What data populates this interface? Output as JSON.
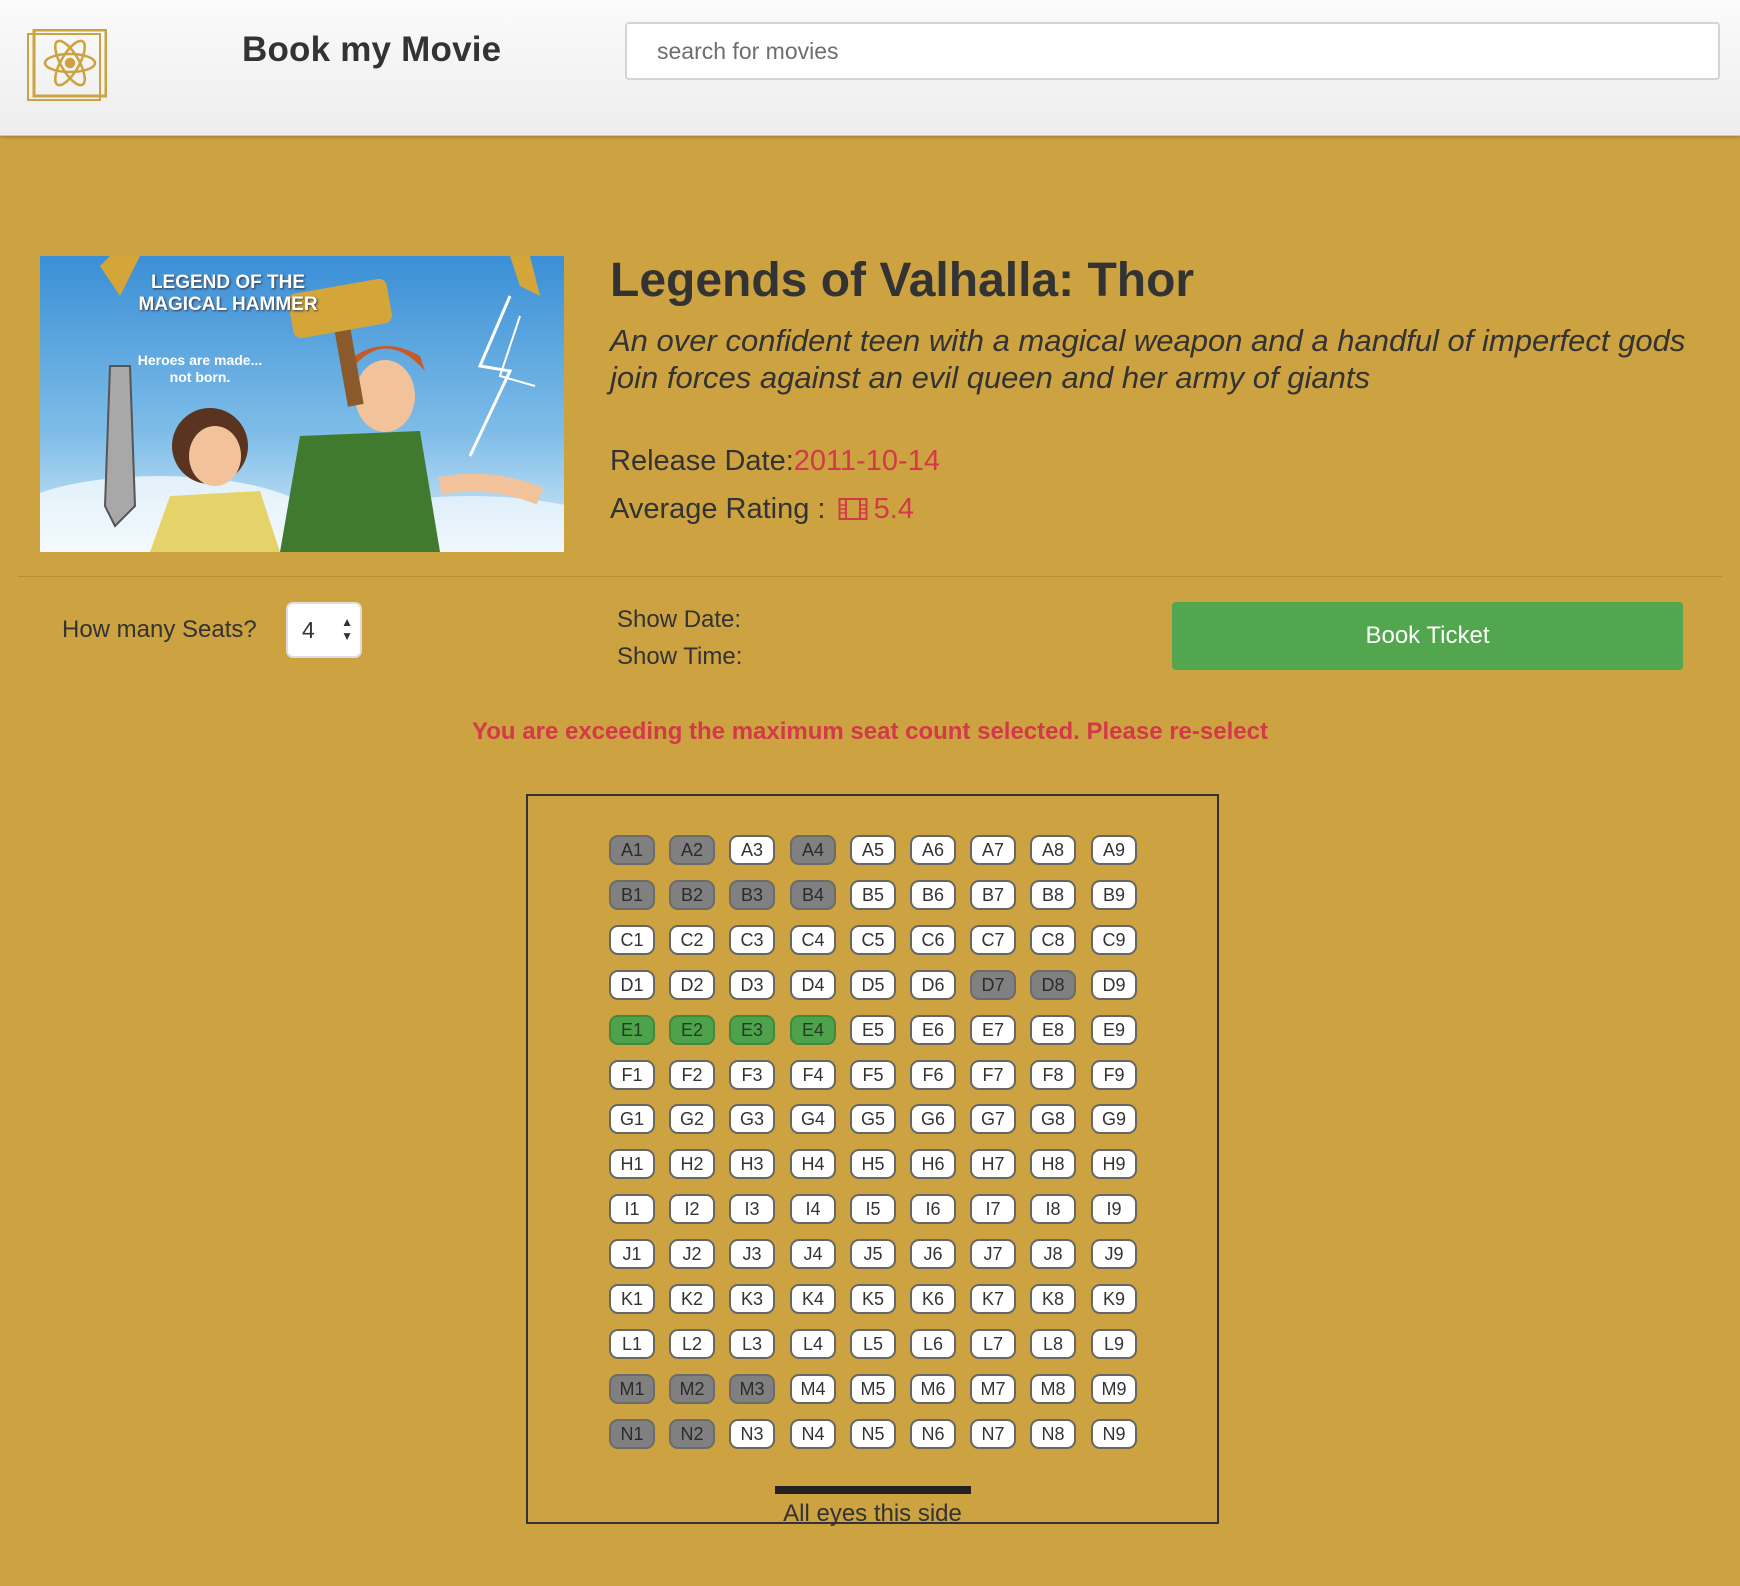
{
  "header": {
    "logo_icon": "react-atom-icon",
    "brand": "Book my Movie",
    "search_placeholder": "search for movies"
  },
  "movie": {
    "poster_icon": "movie-poster-image",
    "poster_text_1": "LEGEND OF THE",
    "poster_text_2": "MAGICAL HAMMER",
    "poster_tagline_1": "Heroes are made...",
    "poster_tagline_2": "not born.",
    "title": "Legends of Valhalla: Thor",
    "overview": "An over confident teen with a magical weapon and a handful of imperfect gods join forces against an evil queen and her army of giants",
    "release_label": "Release Date:",
    "release_date": "2011-10-14",
    "rating_label": "Average Rating :",
    "rating_icon": "film-icon",
    "rating_value": "5.4"
  },
  "booking": {
    "seats_label": "How many Seats?",
    "seats_value": "4",
    "show_date_label": "Show Date:",
    "show_time_label": "Show Time:",
    "book_button": "Book Ticket",
    "error_message": "You are exceeding the maximum seat count selected. Please re-select"
  },
  "seatmap": {
    "rows": [
      "A",
      "B",
      "C",
      "D",
      "E",
      "F",
      "G",
      "H",
      "I",
      "J",
      "K",
      "L",
      "M",
      "N"
    ],
    "columns": [
      1,
      2,
      3,
      4,
      5,
      6,
      7,
      8,
      9
    ],
    "booked": [
      "A1",
      "A2",
      "A4",
      "B1",
      "B2",
      "B3",
      "B4",
      "D7",
      "D8",
      "M1",
      "M2",
      "M3",
      "N1",
      "N2"
    ],
    "selected": [
      "E1",
      "E2",
      "E3",
      "E4"
    ],
    "screen_label": "All eyes this side"
  },
  "colors": {
    "background": "#cda240",
    "accent_red": "#d23a4a",
    "book_green": "#51a64e",
    "booked_gray": "#808080",
    "selected_green": "#4ea24c"
  }
}
